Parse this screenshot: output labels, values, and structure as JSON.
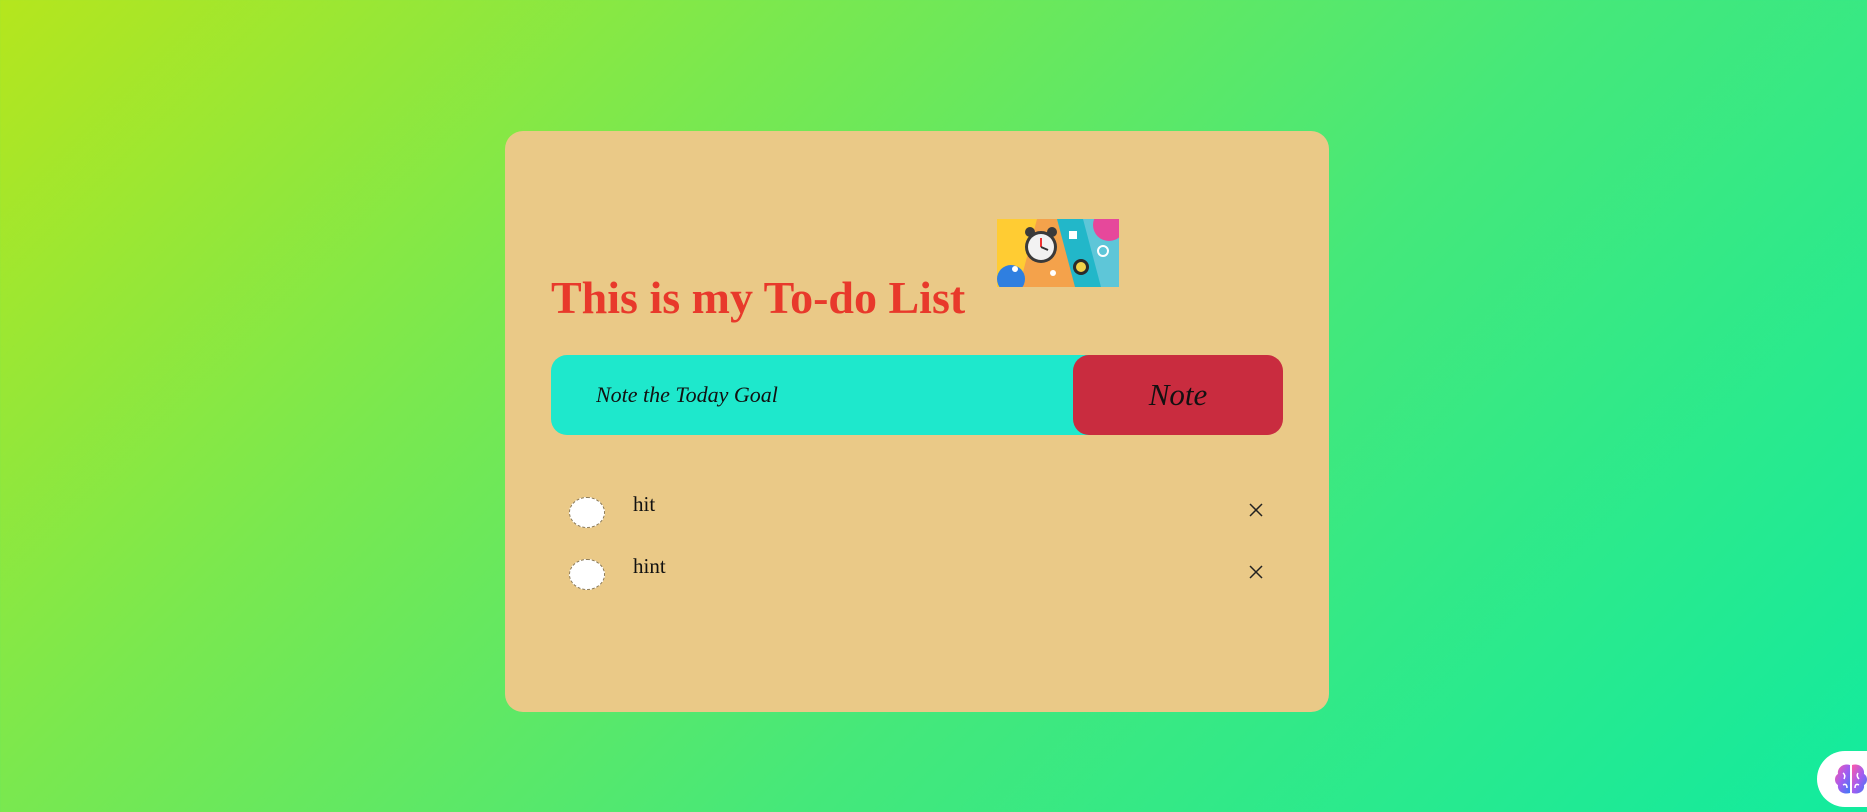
{
  "app": {
    "title": "This is my To-do List"
  },
  "input": {
    "placeholder": "Note the Today Goal",
    "value": ""
  },
  "button": {
    "label": "Note"
  },
  "tasks": [
    {
      "text": "hit",
      "done": false
    },
    {
      "text": "hint",
      "done": false
    }
  ],
  "icons": {
    "header_image": "alarm-clock-illustration",
    "delete": "close-icon",
    "assistant": "brain-icon"
  },
  "colors": {
    "card_background": "#eac987",
    "title": "#e8392b",
    "input_background": "#1ee8cc",
    "button_background": "#c92c3f",
    "page_gradient_start": "#b5e61d",
    "page_gradient_end": "#12eb9e"
  }
}
